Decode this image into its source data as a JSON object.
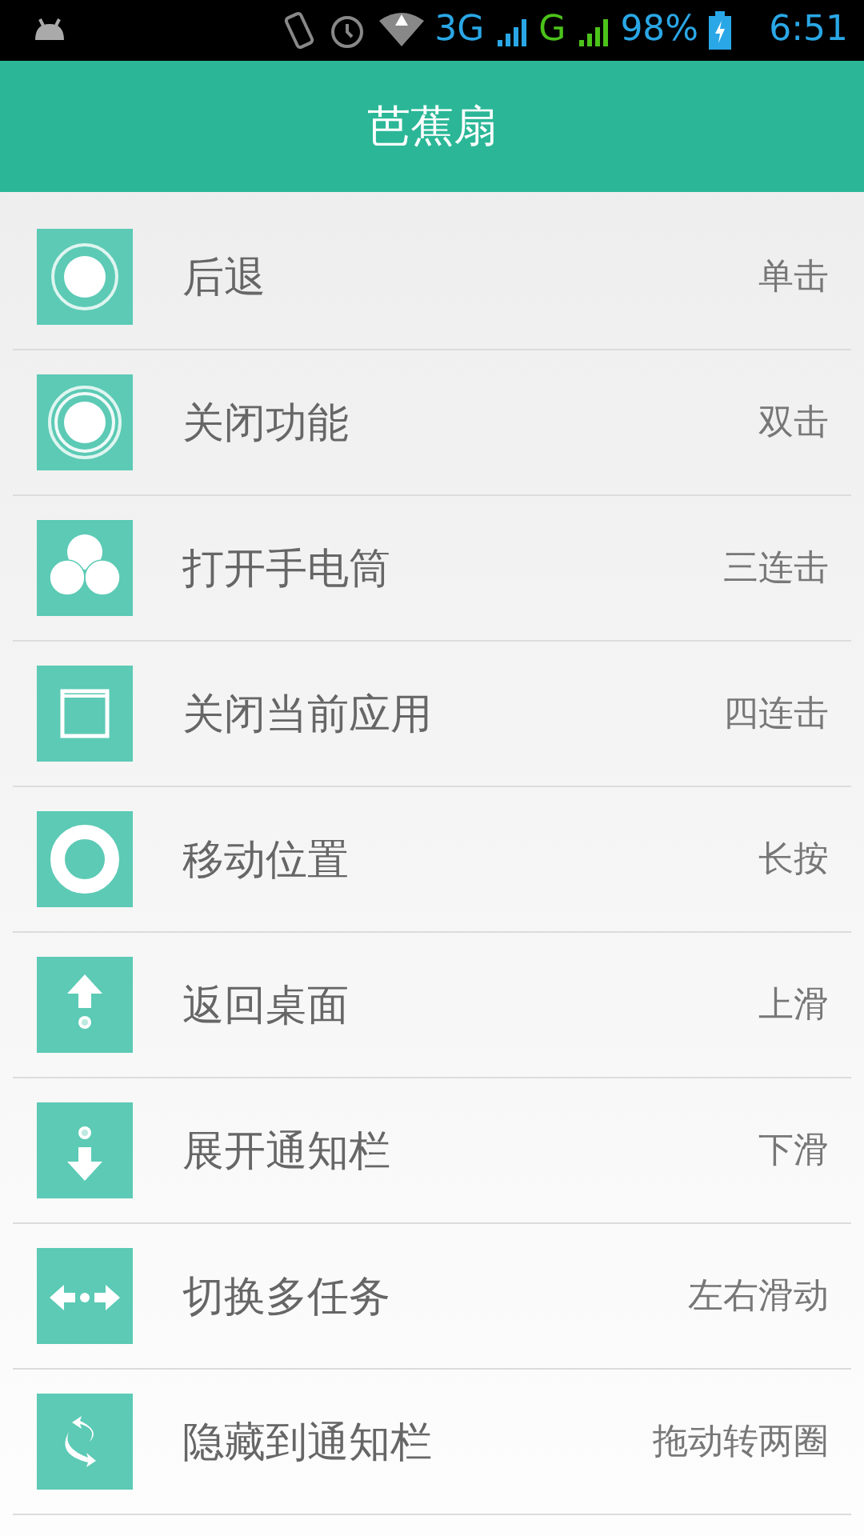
{
  "status_bar": {
    "network_1": "3G",
    "network_2": "G",
    "battery": "98%",
    "time": "6:51"
  },
  "header": {
    "title": "芭蕉扇"
  },
  "gestures": [
    {
      "kind": "single",
      "action": "后退",
      "gesture": "单击"
    },
    {
      "kind": "double",
      "action": "关闭功能",
      "gesture": "双击"
    },
    {
      "kind": "triple",
      "action": "打开手电筒",
      "gesture": "三连击"
    },
    {
      "kind": "window",
      "action": "关闭当前应用",
      "gesture": "四连击"
    },
    {
      "kind": "ring",
      "action": "移动位置",
      "gesture": "长按"
    },
    {
      "kind": "up",
      "action": "返回桌面",
      "gesture": "上滑"
    },
    {
      "kind": "down",
      "action": "展开通知栏",
      "gesture": "下滑"
    },
    {
      "kind": "sideways",
      "action": "切换多任务",
      "gesture": "左右滑动"
    },
    {
      "kind": "rotate",
      "action": "隐藏到通知栏",
      "gesture": "拖动转两圈"
    }
  ]
}
